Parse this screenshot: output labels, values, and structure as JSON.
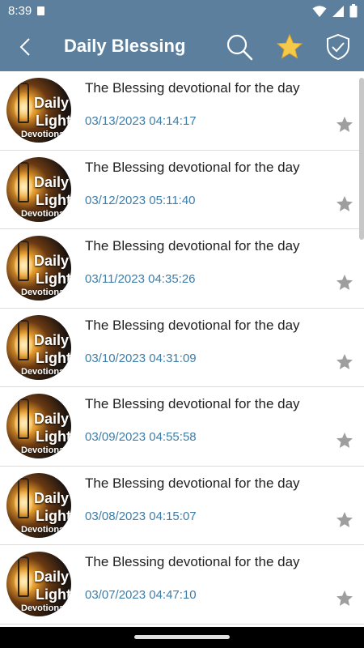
{
  "status_bar": {
    "time": "8:39"
  },
  "app_bar": {
    "title": "Daily Blessing"
  },
  "thumbnail": {
    "line1": "Daily",
    "line2": "Light",
    "line3": "Devotional"
  },
  "colors": {
    "app_bar": "#5b7f9c",
    "date_text": "#3c7da8",
    "fav_star": "#f7c948",
    "row_star": "#9e9e9e"
  },
  "items": [
    {
      "title": "The Blessing devotional for the day",
      "date": "03/13/2023 04:14:17"
    },
    {
      "title": "The Blessing devotional for the day",
      "date": "03/12/2023 05:11:40"
    },
    {
      "title": "The Blessing devotional for the day",
      "date": "03/11/2023 04:35:26"
    },
    {
      "title": "The Blessing devotional for the day",
      "date": "03/10/2023 04:31:09"
    },
    {
      "title": "The Blessing devotional for the day",
      "date": "03/09/2023 04:55:58"
    },
    {
      "title": "The Blessing devotional for the day",
      "date": "03/08/2023 04:15:07"
    },
    {
      "title": "The Blessing devotional for the day",
      "date": "03/07/2023 04:47:10"
    }
  ]
}
